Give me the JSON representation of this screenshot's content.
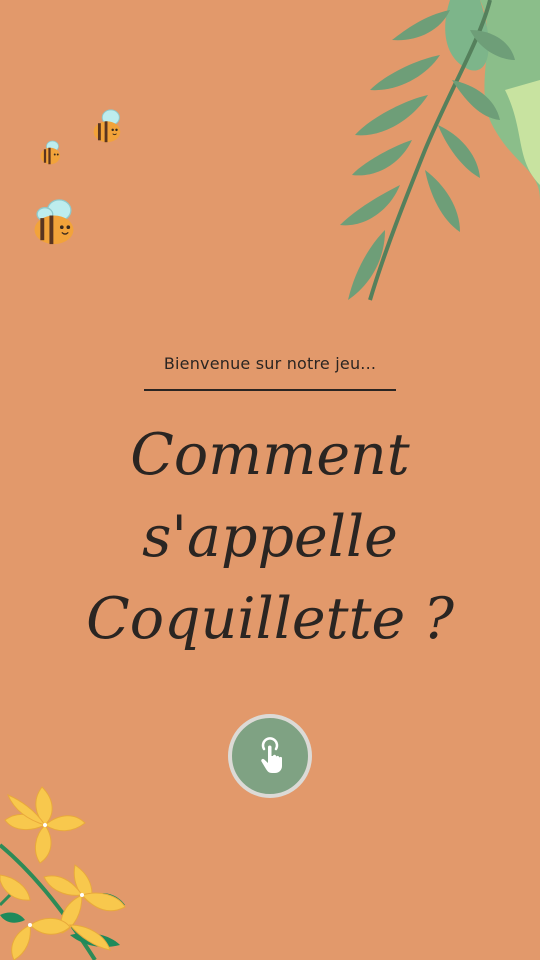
{
  "welcome": {
    "subtitle": "Bienvenue sur notre jeu..."
  },
  "title": {
    "line1": "Comment",
    "line2": "s'appelle",
    "line3": "Coquillette ?"
  },
  "start_button": {
    "icon": "tap-hand-icon"
  },
  "colors": {
    "background": "#E2996B",
    "text": "#2a2522",
    "button": "#7FA283",
    "button_ring": "#DCDAD6",
    "leaf": "#6FA07A",
    "flower": "#F6C64A"
  }
}
